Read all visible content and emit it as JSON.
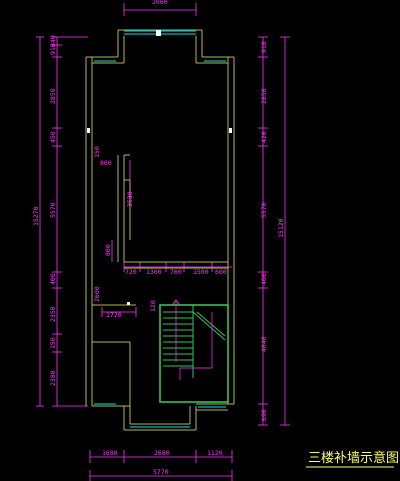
{
  "drawing": {
    "title": "三楼补墙示意图",
    "colors": {
      "background": "#000000",
      "wall": "#b0b84a",
      "dimension": "#ff33ff",
      "window": "#00b7c9",
      "stair": "#35c35a",
      "title": "#ffff66",
      "column": "#ffffff"
    }
  },
  "dimensions": {
    "top": "2060",
    "left_outer": "15270",
    "left_segments": [
      "240",
      "910",
      "2850",
      "450",
      "5570",
      "400",
      "2350",
      "150",
      "2380"
    ],
    "right_outer": "15120",
    "right_segments": [
      "910",
      "2850",
      "420",
      "5570",
      "400",
      "4040",
      "690"
    ],
    "bottom_segments": [
      "1680",
      "2680",
      "1120"
    ],
    "bottom_total": "5770",
    "interior": {
      "upper_small": "150",
      "side_800": "800",
      "wall_3530": "3530",
      "wall_800b": "800",
      "row_a": "720",
      "row_b": "1300",
      "row_c": "760",
      "row_d": "1500",
      "row_e": "600",
      "mid_2600": "2600",
      "mid_1720": "1720",
      "mid_120": "120"
    }
  }
}
